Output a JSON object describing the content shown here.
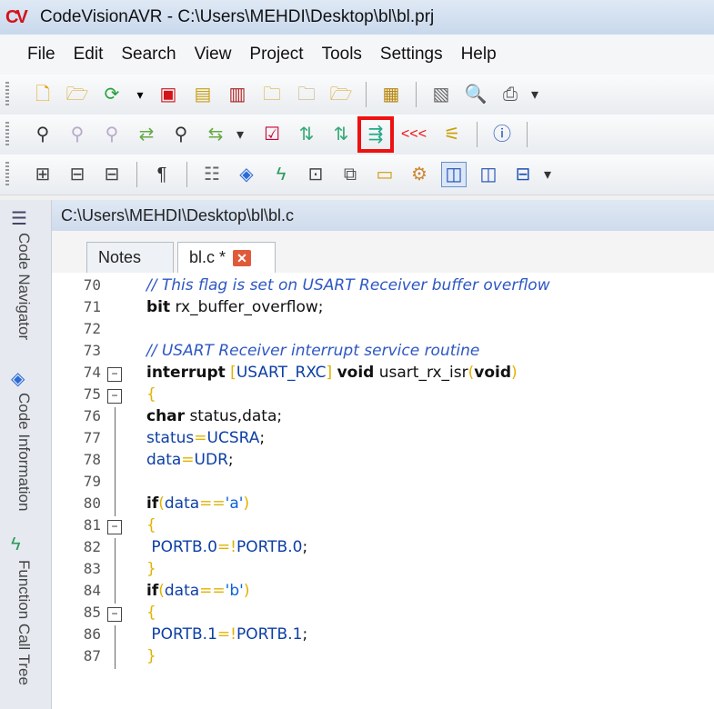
{
  "window": {
    "title": "CodeVisionAVR - C:\\Users\\MEHDI\\Desktop\\bl\\bl.prj",
    "logo": "CV"
  },
  "menu": [
    "File",
    "Edit",
    "Search",
    "View",
    "Project",
    "Tools",
    "Settings",
    "Help"
  ],
  "toolbar1": {
    "icons": [
      "new-file-icon",
      "open-folder-icon",
      "refresh-icon",
      "dropdown-icon",
      "save-icon",
      "save-all-icon",
      "save-project-icon",
      "close-file-icon",
      "close-all-icon",
      "open-project-icon",
      "library-icon",
      "print-setup-icon",
      "print-preview-icon",
      "print-icon"
    ]
  },
  "toolbar2": {
    "icons": [
      "find-icon",
      "find-prev-icon",
      "find-next-icon",
      "replace-icon",
      "find-in-files-icon",
      "replace-in-files-icon",
      "check-syntax-icon",
      "compile-icon",
      "build-icon",
      "build-all-icon",
      "program-chip-icon",
      "clean-icon",
      "info-icon"
    ],
    "highlighted": "build-all-icon"
  },
  "toolbar3": {
    "icons": [
      "expand-icon",
      "collapse-icon",
      "collapse-all-icon",
      "paragraph-icon",
      "code-wizard-icon",
      "chip-icon",
      "function-icon",
      "lcd-icon",
      "terminal-icon",
      "window-icon",
      "debug-icon",
      "layout-1-icon",
      "layout-2-icon",
      "layout-3-icon"
    ]
  },
  "sidebar": {
    "labels": [
      "Code Navigator",
      "Code Information",
      "Function Call Tree"
    ]
  },
  "editor": {
    "path": "C:\\Users\\MEHDI\\Desktop\\bl\\bl.c",
    "tabs": [
      {
        "label": "Notes"
      },
      {
        "label": "bl.c *"
      }
    ],
    "lines": [
      {
        "n": "70",
        "fold": "",
        "parts": [
          [
            "cmt",
            "// This flag is set on USART Receiver buffer overflow"
          ]
        ]
      },
      {
        "n": "71",
        "fold": "",
        "parts": [
          [
            "kw",
            "bit"
          ],
          [
            "plain",
            " rx_buffer_overflow;"
          ]
        ]
      },
      {
        "n": "72",
        "fold": "",
        "parts": []
      },
      {
        "n": "73",
        "fold": "",
        "parts": [
          [
            "cmt",
            "// USART Receiver interrupt service routine"
          ]
        ]
      },
      {
        "n": "74",
        "fold": "minus",
        "parts": [
          [
            "kw",
            "interrupt"
          ],
          [
            "plain",
            " "
          ],
          [
            "op",
            "["
          ],
          [
            "id",
            "USART_RXC"
          ],
          [
            "op",
            "]"
          ],
          [
            "plain",
            " "
          ],
          [
            "kw",
            "void"
          ],
          [
            "plain",
            " usart_rx_isr"
          ],
          [
            "op",
            "("
          ],
          [
            "kw",
            "void"
          ],
          [
            "op",
            ")"
          ]
        ]
      },
      {
        "n": "75",
        "fold": "minus",
        "parts": [
          [
            "op",
            "{"
          ]
        ]
      },
      {
        "n": "76",
        "fold": "",
        "parts": [
          [
            "kw",
            "char"
          ],
          [
            "plain",
            " status,data;"
          ]
        ]
      },
      {
        "n": "77",
        "fold": "",
        "parts": [
          [
            "id",
            "status"
          ],
          [
            "op",
            "="
          ],
          [
            "id",
            "UCSRA"
          ],
          [
            "plain",
            ";"
          ]
        ]
      },
      {
        "n": "78",
        "fold": "",
        "parts": [
          [
            "id",
            "data"
          ],
          [
            "op",
            "="
          ],
          [
            "id",
            "UDR"
          ],
          [
            "plain",
            ";"
          ]
        ]
      },
      {
        "n": "79",
        "fold": "",
        "parts": []
      },
      {
        "n": "80",
        "fold": "",
        "parts": [
          [
            "kw",
            "if"
          ],
          [
            "op",
            "("
          ],
          [
            "id",
            "data"
          ],
          [
            "op",
            "=="
          ],
          [
            "str",
            "'a'"
          ],
          [
            "op",
            ")"
          ]
        ]
      },
      {
        "n": "81",
        "fold": "minus",
        "parts": [
          [
            "op",
            "{"
          ]
        ]
      },
      {
        "n": "82",
        "fold": "",
        "parts": [
          [
            "plain",
            " "
          ],
          [
            "id",
            "PORTB.0"
          ],
          [
            "op",
            "=!"
          ],
          [
            "id",
            "PORTB.0"
          ],
          [
            "plain",
            ";"
          ]
        ]
      },
      {
        "n": "83",
        "fold": "",
        "parts": [
          [
            "op",
            "}"
          ]
        ]
      },
      {
        "n": "84",
        "fold": "",
        "parts": [
          [
            "kw",
            "if"
          ],
          [
            "op",
            "("
          ],
          [
            "id",
            "data"
          ],
          [
            "op",
            "=="
          ],
          [
            "str",
            "'b'"
          ],
          [
            "op",
            ")"
          ]
        ]
      },
      {
        "n": "85",
        "fold": "minus",
        "parts": [
          [
            "op",
            "{"
          ]
        ]
      },
      {
        "n": "86",
        "fold": "",
        "parts": [
          [
            "plain",
            " "
          ],
          [
            "id",
            "PORTB.1"
          ],
          [
            "op",
            "=!"
          ],
          [
            "id",
            "PORTB.1"
          ],
          [
            "plain",
            ";"
          ]
        ]
      },
      {
        "n": "87",
        "fold": "",
        "parts": [
          [
            "op",
            "}"
          ]
        ]
      }
    ]
  }
}
